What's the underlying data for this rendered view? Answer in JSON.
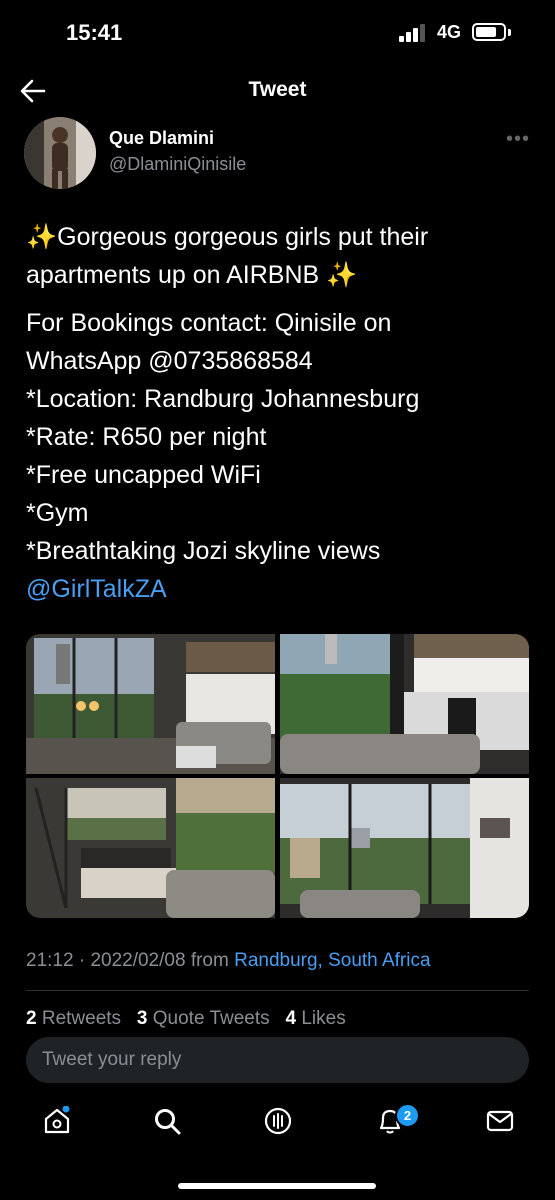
{
  "status_bar": {
    "time": "15:41",
    "network": "4G",
    "battery_level": 0.7
  },
  "nav": {
    "title": "Tweet",
    "back_icon": "arrow-left-icon"
  },
  "author": {
    "name": "Que Dlamini",
    "handle": "@DlaminiQinisile"
  },
  "tweet": {
    "lines": [
      "Gorgeous gorgeous girls put their",
      "apartments up on AIRBNB"
    ],
    "sparkle": "✨",
    "body": [
      "For Bookings contact: Qinisile on",
      "WhatsApp @0735868584",
      "*Location: Randburg Johannesburg",
      "*Rate: R650 per night",
      "*Free uncapped WiFi",
      "*Gym",
      "*Breathtaking Jozi skyline views"
    ],
    "mention": "@GirlTalkZA",
    "photos": [
      "Living room with window view",
      "Kitchen and lounge",
      "Bedroom",
      "City view from window"
    ]
  },
  "meta": {
    "time": "21:12",
    "date": "2022/02/08",
    "from": "from",
    "location": "Randburg, South Africa"
  },
  "stats": {
    "retweets_count": "2",
    "retweets_label": "Retweets",
    "quotes_count": "3",
    "quotes_label": "Quote Tweets",
    "likes_count": "4",
    "likes_label": "Likes"
  },
  "reply": {
    "placeholder": "Tweet your reply"
  },
  "tabbar": {
    "items": [
      "home-icon",
      "search-icon",
      "spaces-icon",
      "notifications-icon",
      "messages-icon"
    ],
    "notifications_badge": "2",
    "accent": "#1d9bf0"
  },
  "colors": {
    "link": "#4a9ef2",
    "muted": "#8b8f95",
    "background": "#000000"
  }
}
